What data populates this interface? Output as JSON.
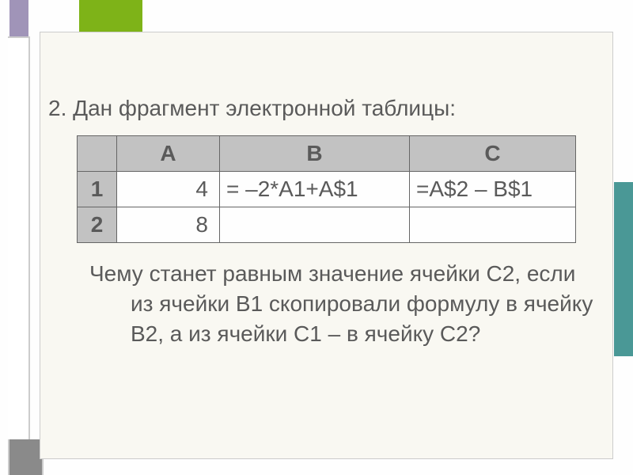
{
  "prompt": "2. Дан фрагмент электронной таблицы:",
  "table": {
    "corner": "",
    "headers": {
      "a": "A",
      "b": "B",
      "c": "C"
    },
    "rows": [
      {
        "label": "1",
        "a": "4 ",
        "b": "= –2*A1+A$1",
        "c": "=A$2 – B$1"
      },
      {
        "label": "2",
        "a": "8 ",
        "b": "",
        "c": ""
      }
    ]
  },
  "question": "Чему станет равным значение ячейки С2, если из ячейки B1 скопировали формулу в ячейку B2, а из ячейки C1 – в ячейку С2?"
}
